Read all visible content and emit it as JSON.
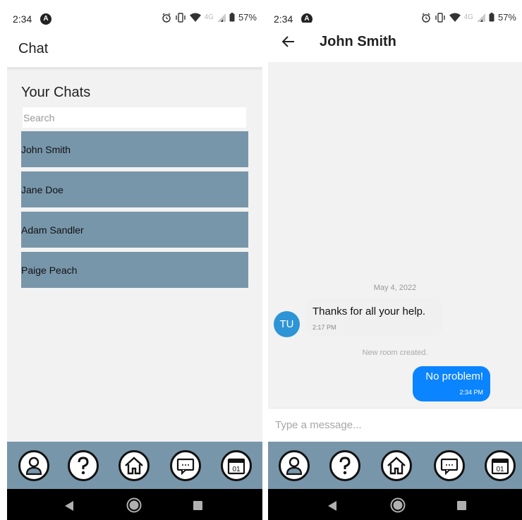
{
  "status": {
    "time": "2:34",
    "network": "4G",
    "battery": "57%"
  },
  "chat_list_screen": {
    "app_title": "Chat",
    "heading": "Your Chats",
    "search": {
      "placeholder": "Search",
      "value": ""
    },
    "chats": [
      {
        "name": "John Smith"
      },
      {
        "name": "Jane Doe"
      },
      {
        "name": "Adam Sandler"
      },
      {
        "name": "Paige Peach"
      }
    ]
  },
  "conversation_screen": {
    "contact_name": "John Smith",
    "date_separator": "May 4, 2022",
    "messages": [
      {
        "direction": "incoming",
        "avatar_initials": "TU",
        "text": "Thanks for all your help.",
        "time": "2:17 PM"
      },
      {
        "direction": "system",
        "text": "New room created."
      },
      {
        "direction": "outgoing",
        "text": "No problem!",
        "time": "2:34 PM"
      }
    ],
    "composer": {
      "placeholder": "Type a message...",
      "value": ""
    }
  },
  "tab_bar": {
    "items": [
      {
        "icon": "profile-icon"
      },
      {
        "icon": "help-icon"
      },
      {
        "icon": "home-icon"
      },
      {
        "icon": "chat-icon"
      },
      {
        "icon": "calendar-icon",
        "label": "01"
      }
    ]
  },
  "colors": {
    "accent_steel": "#7896aa",
    "outgoing_bubble": "#0a84ff",
    "avatar": "#2d94d6",
    "background": "#f2f2f2"
  }
}
